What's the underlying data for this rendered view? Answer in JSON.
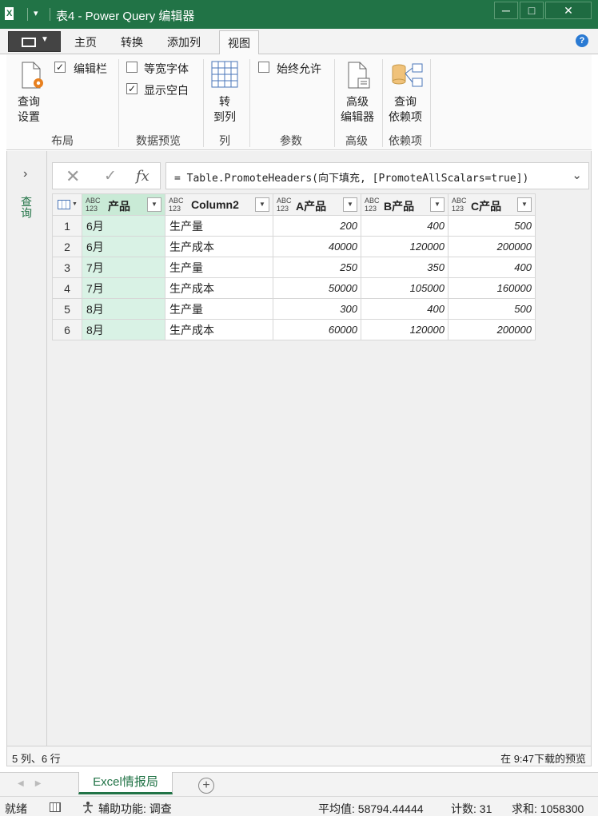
{
  "window": {
    "title": "表4 - Power Query 编辑器",
    "logo": "X",
    "qat_label": "▾",
    "minimize": "─",
    "maximize": "□",
    "close": "✕"
  },
  "ribbon_tabs": [
    "主页",
    "转换",
    "添加列",
    "视图"
  ],
  "active_tab": "视图",
  "help_label": "?",
  "ribbon": {
    "layout": {
      "query_settings": [
        "查询",
        "设置"
      ],
      "formula_bar": "编辑栏",
      "formula_bar_checked": true,
      "label": "布局"
    },
    "data_preview": {
      "monospace": "等宽字体",
      "monospace_checked": false,
      "show_whitespace": "显示空白",
      "show_whitespace_checked": true,
      "label": "数据预览"
    },
    "columns": {
      "go_to_column": [
        "转",
        "到列"
      ],
      "label": "列"
    },
    "parameters": {
      "always_allow": "始终允许",
      "always_allow_checked": false,
      "label": "参数"
    },
    "advanced": {
      "advanced_editor": [
        "高级",
        "编辑器"
      ],
      "label": "高级"
    },
    "dependencies": {
      "query_dependencies": [
        "查询",
        "依赖项"
      ],
      "label": "依赖项"
    }
  },
  "nav_pane": {
    "expand": "›",
    "label": "查询"
  },
  "formula_bar": {
    "cancel": "✕",
    "commit": "✓",
    "fx": "fx",
    "formula": "= Table.PromoteHeaders(向下填充, [PromoteAllScalars=true])",
    "expand": "⌄"
  },
  "grid": {
    "type_badge": [
      "ABC",
      "123"
    ],
    "columns": [
      "产品",
      "Column2",
      "A产品",
      "B产品",
      "C产品"
    ],
    "selected_column": 0,
    "rows": [
      [
        "1",
        "6月",
        "生产量",
        "200",
        "400",
        "500"
      ],
      [
        "2",
        "6月",
        "生产成本",
        "40000",
        "120000",
        "200000"
      ],
      [
        "3",
        "7月",
        "生产量",
        "250",
        "350",
        "400"
      ],
      [
        "4",
        "7月",
        "生产成本",
        "50000",
        "105000",
        "160000"
      ],
      [
        "5",
        "8月",
        "生产量",
        "300",
        "400",
        "500"
      ],
      [
        "6",
        "8月",
        "生产成本",
        "60000",
        "120000",
        "200000"
      ]
    ]
  },
  "editor_status": {
    "left": "5 列、6 行",
    "right": "在 9:47下载的预览"
  },
  "sheetbar": {
    "sheet_tab": "Excel情报局",
    "add": "+"
  },
  "statusbar": {
    "ready": "就绪",
    "accessibility": "辅助功能: 调查",
    "average": "平均值: 58794.44444",
    "count": "计数: 31",
    "sum": "求和: 1058300"
  },
  "colors": {
    "accent": "#217346",
    "selected_column": "#d9f2e5"
  }
}
